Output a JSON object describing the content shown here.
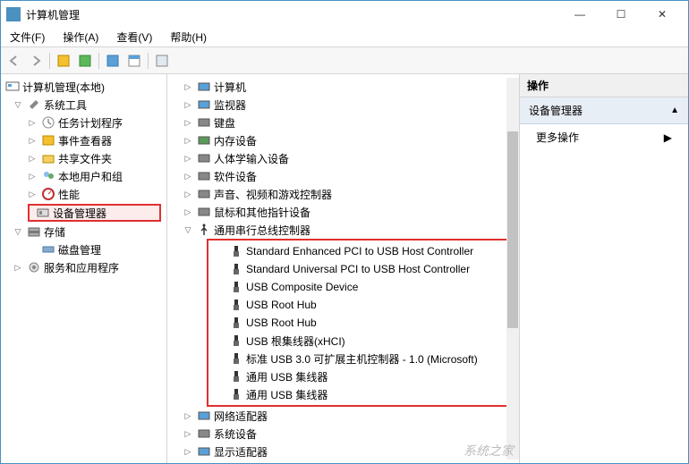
{
  "window": {
    "title": "计算机管理",
    "btn_min": "—",
    "btn_max": "☐",
    "btn_close": "✕"
  },
  "menu": {
    "file": "文件(F)",
    "action": "操作(A)",
    "view": "查看(V)",
    "help": "帮助(H)"
  },
  "left_tree": {
    "root": "计算机管理(本地)",
    "system_tools": "系统工具",
    "task_scheduler": "任务计划程序",
    "event_viewer": "事件查看器",
    "shared_folders": "共享文件夹",
    "local_users": "本地用户和组",
    "performance": "性能",
    "device_manager": "设备管理器",
    "storage": "存储",
    "disk_mgmt": "磁盘管理",
    "services_apps": "服务和应用程序"
  },
  "mid_tree": {
    "computer": "计算机",
    "monitor": "监视器",
    "keyboard": "键盘",
    "memory": "内存设备",
    "hid": "人体学输入设备",
    "software": "软件设备",
    "audio": "声音、视频和游戏控制器",
    "mouse": "鼠标和其他指针设备",
    "usb_ctrl": "通用串行总线控制器",
    "usb_children": [
      "Standard Enhanced PCI to USB Host Controller",
      "Standard Universal PCI to USB Host Controller",
      "USB Composite Device",
      "USB Root Hub",
      "USB Root Hub",
      "USB 根集线器(xHCI)",
      "标准 USB 3.0 可扩展主机控制器 - 1.0 (Microsoft)",
      "通用 USB 集线器",
      "通用 USB 集线器"
    ],
    "network": "网络适配器",
    "sysdev": "系统设备",
    "display": "显示适配器"
  },
  "right": {
    "header": "操作",
    "section": "设备管理器",
    "more_actions": "更多操作",
    "arrow_up": "▲",
    "arrow_right": "▶"
  },
  "icons": {
    "back": "⮜",
    "fwd": "⮞",
    "collapsed": "▷",
    "expanded": "▽"
  },
  "watermark": "系统之家"
}
